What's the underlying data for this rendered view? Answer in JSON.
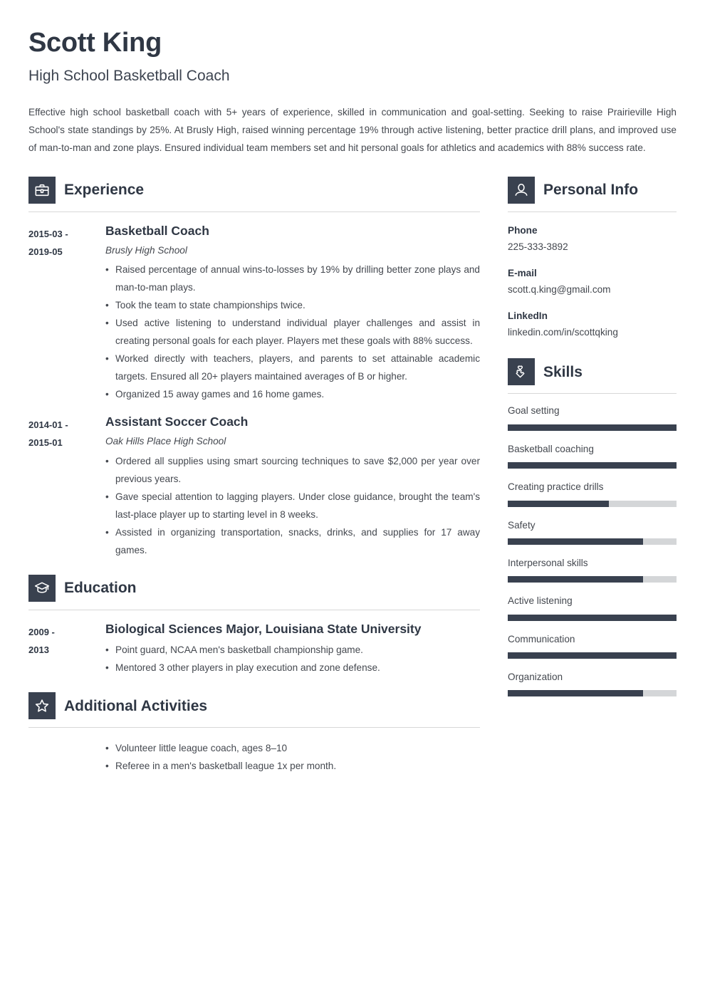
{
  "header": {
    "name": "Scott King",
    "job_title": "High School Basketball Coach",
    "summary": "Effective high school basketball coach with 5+ years of experience, skilled in communication and goal-setting. Seeking to raise Prairieville High School's state standings by 25%. At Brusly High, raised winning percentage 19% through active listening, better practice drill plans, and improved use of man-to-man and zone plays. Ensured individual team members set and hit personal goals for athletics and academics with 88% success rate."
  },
  "colors": {
    "accent_dark": "#39414f",
    "heading": "#2f3744",
    "body_text": "#44484f",
    "divider": "#d8d8d8",
    "track": "#d4d6d8"
  },
  "sections": {
    "experience": {
      "title": "Experience",
      "icon": "briefcase-icon",
      "entries": [
        {
          "dates": "2015-03 - 2019-05",
          "date_line_1": "2015-03 -",
          "date_line_2": "2019-05",
          "title": "Basketball Coach",
          "subtitle": "Brusly High School",
          "bullets": [
            "Raised percentage of annual wins-to-losses by 19% by drilling better zone plays and man-to-man plays.",
            "Took the team to state championships twice.",
            "Used active listening to understand individual player challenges and assist in creating personal goals for each player. Players met these goals with 88% success.",
            "Worked directly with teachers, players, and parents to set attainable academic targets. Ensured all 20+ players maintained averages of B or higher.",
            "Organized 15 away games and 16 home games."
          ]
        },
        {
          "dates": "2014-01 - 2015-01",
          "date_line_1": "2014-01 -",
          "date_line_2": "2015-01",
          "title": "Assistant Soccer Coach",
          "subtitle": "Oak Hills Place High School",
          "bullets": [
            "Ordered all supplies using smart sourcing techniques to save $2,000 per year over previous years.",
            "Gave special attention to lagging players. Under close guidance, brought the team's last-place player up to starting level in 8 weeks.",
            "Assisted in organizing transportation, snacks, drinks, and supplies for 17 away games."
          ]
        }
      ]
    },
    "education": {
      "title": "Education",
      "icon": "graduation-cap-icon",
      "entries": [
        {
          "dates": "2009 - 2013",
          "date_line_1": "2009 -",
          "date_line_2": "2013",
          "title": "Biological Sciences Major, Louisiana State University",
          "bullets": [
            "Point guard, NCAA men's basketball championship game.",
            "Mentored 3 other players in play execution and zone defense."
          ]
        }
      ]
    },
    "additional_activities": {
      "title": "Additional Activities",
      "icon": "star-icon",
      "bullets": [
        "Volunteer little league coach, ages 8–10",
        "Referee in a men's basketball league 1x per month."
      ]
    },
    "personal_info": {
      "title": "Personal Info",
      "icon": "person-icon",
      "items": [
        {
          "label": "Phone",
          "value": "225-333-3892"
        },
        {
          "label": "E-mail",
          "value": "scott.q.king@gmail.com"
        },
        {
          "label": "LinkedIn",
          "value": "linkedin.com/in/scottqking"
        }
      ]
    },
    "skills": {
      "title": "Skills",
      "icon": "puzzle-piece-icon",
      "items": [
        {
          "name": "Goal setting",
          "level": 100
        },
        {
          "name": "Basketball coaching",
          "level": 100
        },
        {
          "name": "Creating practice drills",
          "level": 60
        },
        {
          "name": "Safety",
          "level": 80
        },
        {
          "name": "Interpersonal skills",
          "level": 80
        },
        {
          "name": "Active listening",
          "level": 100
        },
        {
          "name": "Communication",
          "level": 100
        },
        {
          "name": "Organization",
          "level": 80
        }
      ]
    }
  }
}
